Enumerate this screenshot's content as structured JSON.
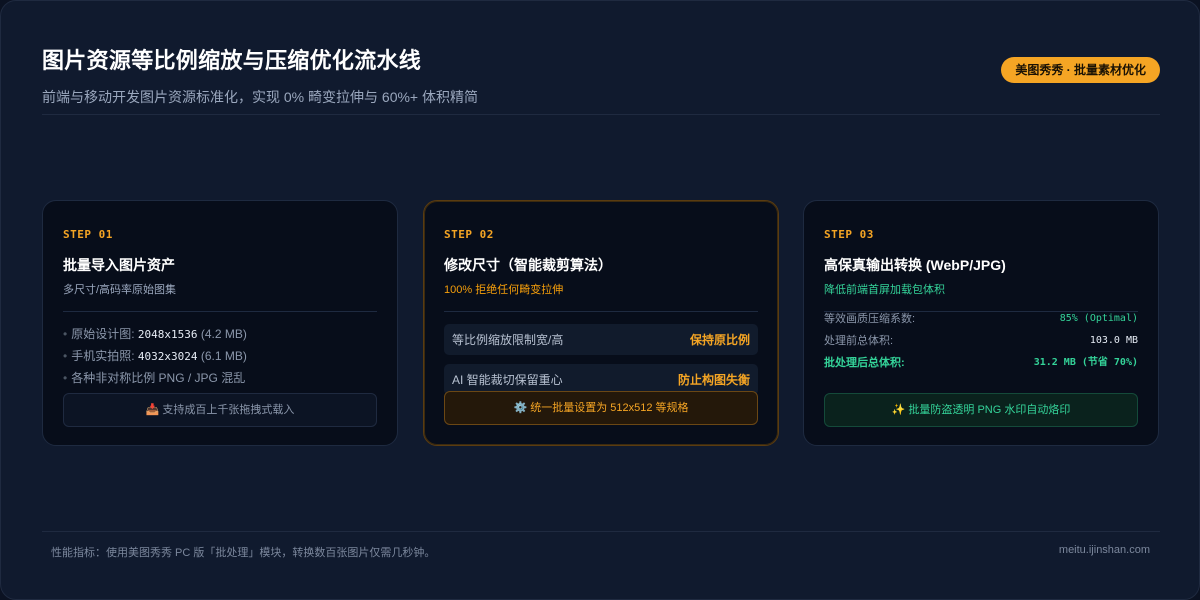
{
  "header": {
    "title": "图片资源等比例缩放与压缩优化流水线",
    "subtitle": "前端与移动开发图片资源标准化，实现 0% 畸变拉伸与 60%+ 体积精简",
    "badge": "美图秀秀 · 批量素材优化"
  },
  "step1": {
    "step": "STEP 01",
    "title": "批量导入图片资产",
    "sub": "多尺寸/高码率原始图集",
    "items": [
      {
        "label": "原始设计图: ",
        "value": "2048x1536",
        "size": "(4.2 MB)"
      },
      {
        "label": "手机实拍照: ",
        "value": "4032x3024",
        "size": "(6.1 MB)"
      },
      {
        "label": "各种非对称比例 PNG / JPG 混乱"
      }
    ],
    "note_icon": "📥",
    "note": "支持成百上千张拖拽式载入"
  },
  "step2": {
    "step": "STEP 02",
    "title": "修改尺寸（智能裁剪算法）",
    "sub": "100% 拒绝任何畸变拉伸",
    "rows": [
      {
        "label": "等比例缩放限制宽/高",
        "tag": "保持原比例"
      },
      {
        "label": "AI 智能裁切保留重心",
        "tag": "防止构图失衡"
      }
    ],
    "cta_icon": "⚙️",
    "cta": "统一批量设置为 512x512 等规格"
  },
  "step3": {
    "step": "STEP 03",
    "title": "高保真输出转换 (WebP/JPG)",
    "sub": "降低前端首屏加载包体积",
    "rows": [
      {
        "k": "等效画质压缩系数:",
        "v": "85% (Optimal)"
      },
      {
        "k": "处理前总体积:",
        "v": "103.0 MB"
      },
      {
        "k": "批处理后总体积:",
        "v": "31.2 MB (节省 70%)"
      }
    ],
    "cta_icon": "✨",
    "cta": "批量防盗透明 PNG 水印自动烙印"
  },
  "footer": {
    "left": "性能指标：使用美图秀秀 PC 版「批处理」模块，转换数百张图片仅需几秒钟。",
    "right": "meitu.ijinshan.com"
  },
  "colors": {
    "accent_orange": "#f5a524",
    "accent_green": "#34d399",
    "background": "#101a2e",
    "card": "#070d1a"
  }
}
